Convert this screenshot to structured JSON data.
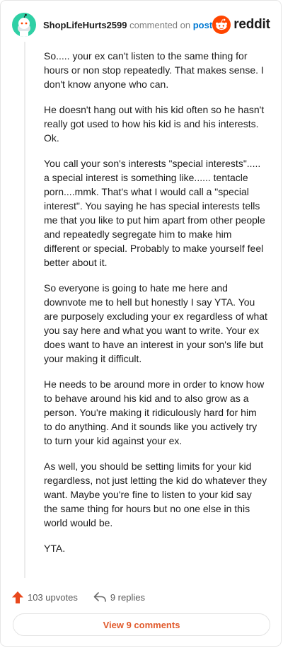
{
  "comment": {
    "username": "ShopLifeHurts2599",
    "action_text": "commented on",
    "post_link_label": "post",
    "paragraphs": [
      "So..... your ex can't listen to the same thing for hours or non stop repeatedly. That makes sense. I don't know anyone who can.",
      "He doesn't hang out with his kid often so he hasn't really got used to how his kid is and his interests. Ok.",
      "You call your son's interests \"special interests\"..... a special interest is something like...... tentacle porn....mmk. That's what I would call a \"special interest\". You saying he has special interests tells me that you like to put him apart from other people and repeatedly segregate him to make him different or special. Probably to make yourself feel better about it.",
      "So everyone is going to hate me here and downvote me to hell but honestly I say YTA. You are purposely excluding your ex regardless of what you say here and what you want to write. Your ex does want to have an interest in your son's life but your making it difficult.",
      "He needs to be around more in order to know how to behave around his kid and to also grow as a person. You're making it ridiculously hard for him to do anything. And it sounds like you actively try to turn your kid against your ex.",
      "As well, you should be setting limits for your kid regardless, not just letting the kid do whatever they want. Maybe you're fine to listen to your kid say the same thing for hours but no one else in this world would be.",
      "YTA."
    ],
    "upvotes_label": "103 upvotes",
    "replies_label": "9 replies"
  },
  "brand": {
    "wordmark": "reddit"
  },
  "actions": {
    "view_comments_label": "View 9 comments"
  },
  "colors": {
    "brand_orange": "#ff4500",
    "upvote_orange": "#e8481c",
    "link_blue": "#0079d3",
    "avatar_teal": "#2fd0a5"
  },
  "icons": {
    "avatar": "snoo-avatar",
    "logo": "reddit-snoo-icon",
    "upvote": "upvote-arrow-icon",
    "reply": "reply-arrow-icon"
  }
}
